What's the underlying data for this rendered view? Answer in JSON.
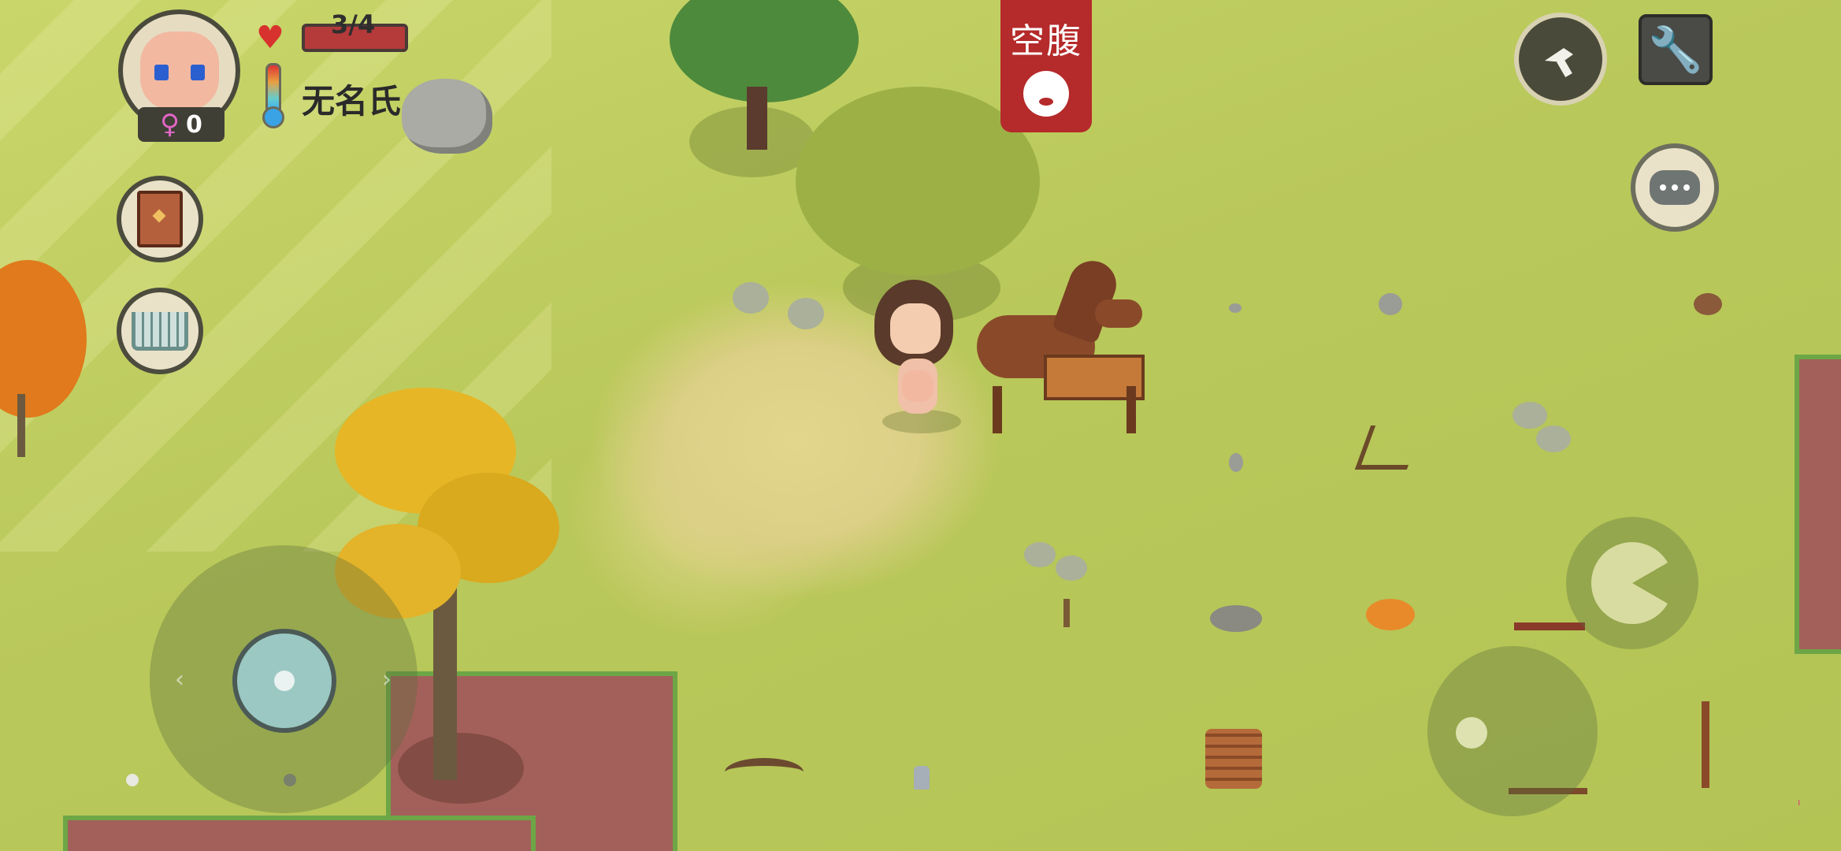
{
  "hud": {
    "health_text": "3/4",
    "player_name": "无名氏",
    "gender_symbol": "♀",
    "gender_count": "0",
    "health_current": 3,
    "health_max": 4
  },
  "status": {
    "label": "空腹"
  },
  "icons": {
    "heart": "heart-icon",
    "thermometer": "thermometer-icon",
    "journal": "book-icon",
    "shop": "cart-icon",
    "weapon": "knife-icon",
    "settings": "wrench-icon",
    "chat": "chat-bubble-icon",
    "eat": "pacman-icon",
    "throw": "throw-icon"
  },
  "colors": {
    "hp_bar": "#b53a3a",
    "status_flag": "#b52a2a",
    "grass": "#b9c85a"
  }
}
